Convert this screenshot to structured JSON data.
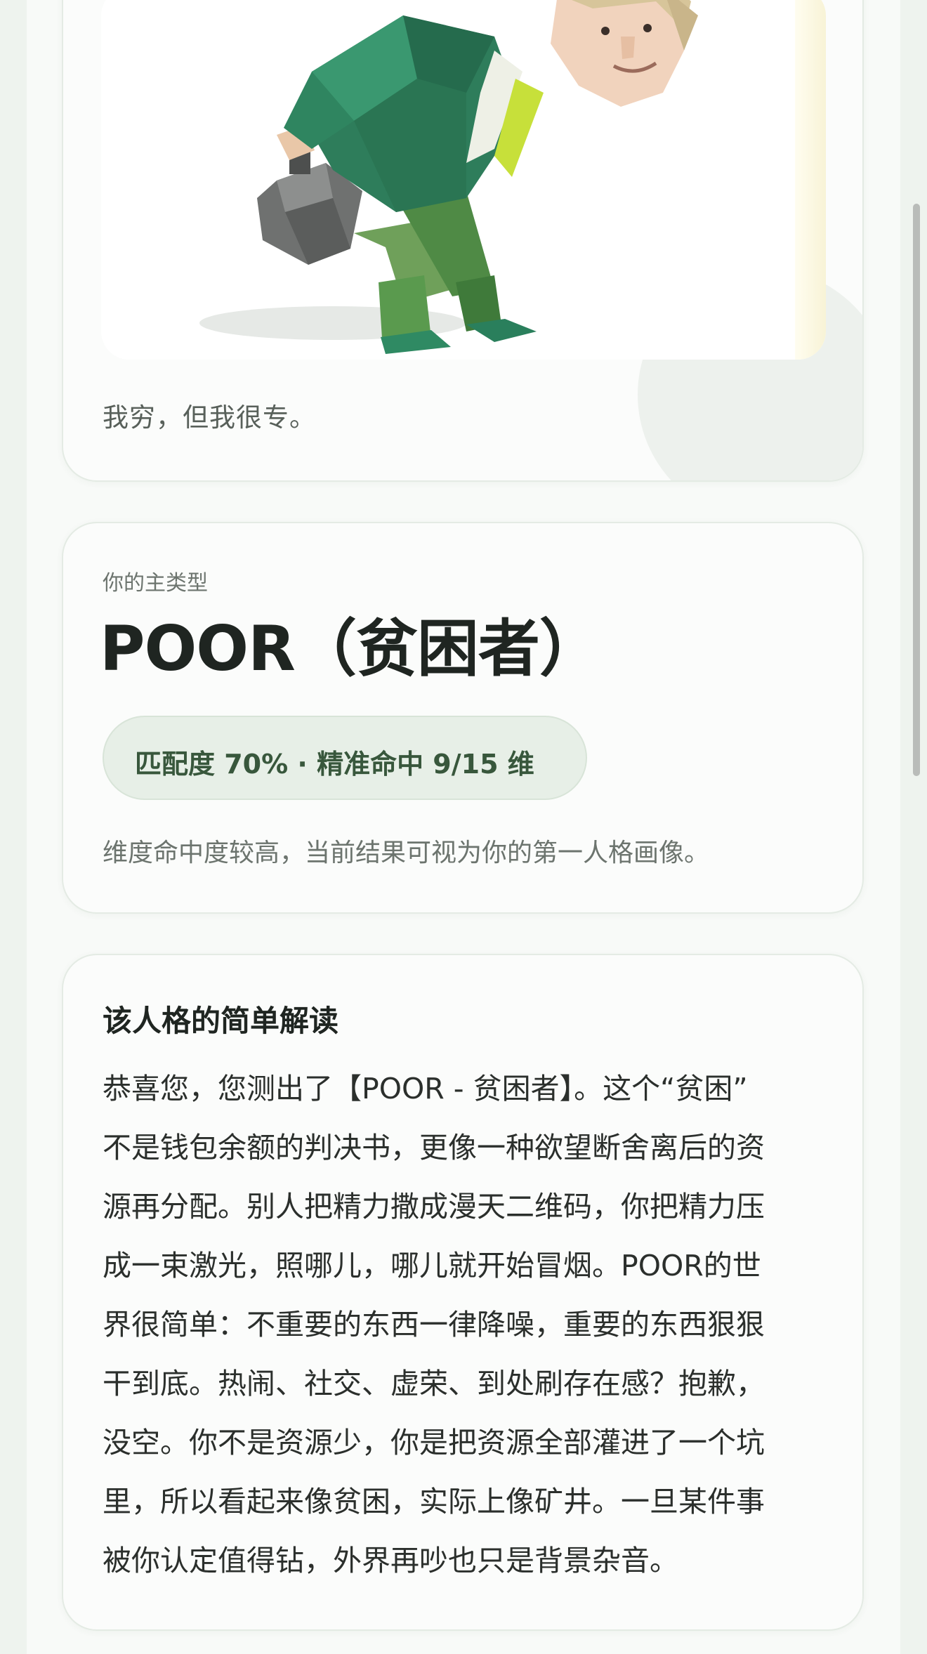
{
  "hero": {
    "image_alt": "low-poly bald-ish man in green suit bending over holding a grey bag",
    "tagline": "我穷，但我很专。"
  },
  "type_card": {
    "label": "你的主类型",
    "title": "POOR（贫困者）",
    "match_pill": "匹配度 70% · 精准命中 9/15 维",
    "description": "维度命中度较高，当前结果可视为你的第一人格画像。"
  },
  "reading_card": {
    "title": "该人格的简单解读",
    "lines": [
      "恭喜您，您测出了【POOR - 贫困者】。这个“贫困”",
      "不是钱包余额的判决书，更像一种欲望断舍离后的资",
      "源再分配。别人把精力撒成漫天二维码，你把精力压",
      "成一束激光，照哪儿，哪儿就开始冒烟。POOR的世",
      "界很简单：不重要的东西一律降噪，重要的东西狠狠",
      "干到底。热闹、社交、虚荣、到处刷存在感？抱歉，",
      "没空。你不是资源少，你是把资源全部灌进了一个坑",
      "里，所以看起来像贫困，实际上像矿井。一旦某件事",
      "被你认定值得钻，外界再吵也只是背景杂音。"
    ]
  },
  "colors": {
    "accent_green": "#38573c",
    "pill_bg": "#e7efe7",
    "page_bg": "#eef3ee"
  }
}
